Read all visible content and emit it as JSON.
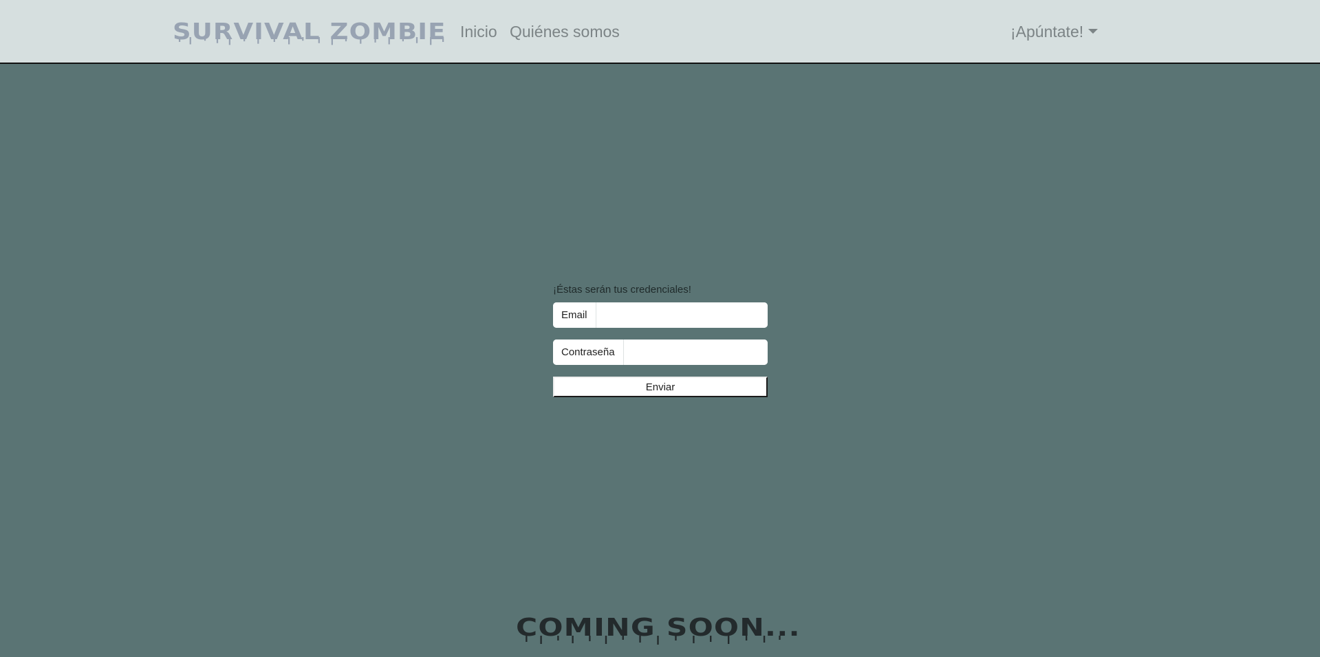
{
  "navbar": {
    "brand": "SURVIVAL ZOMBIE",
    "links": [
      {
        "label": "Inicio"
      },
      {
        "label": "Quiénes somos"
      }
    ],
    "dropdown": {
      "label": "¡Apúntate!",
      "icon": "caret-down-icon"
    }
  },
  "form": {
    "heading": "¡Éstas serán tus credenciales!",
    "email_label": "Email",
    "email_value": "",
    "password_label": "Contraseña",
    "password_value": "",
    "submit_label": "Enviar"
  },
  "footer": {
    "coming_soon": "COMING SOON..."
  },
  "colors": {
    "navbar_bg": "#d6dfdf",
    "page_bg": "#5a7474",
    "brand": "#98a3b2",
    "nav_link": "#7c8486",
    "coming_soon": "#232a2c"
  }
}
